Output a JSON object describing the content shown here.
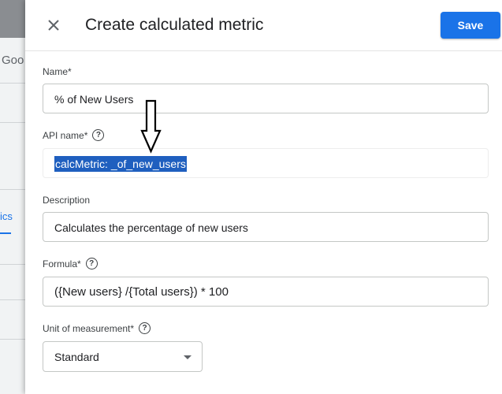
{
  "background": {
    "brand_fragment": "Goo",
    "tab_fragment": "ics"
  },
  "dialog": {
    "title": "Create calculated metric",
    "save_label": "Save"
  },
  "fields": {
    "name": {
      "label": "Name*",
      "value": "% of New Users"
    },
    "api_name": {
      "label": "API name*",
      "value_part1": "calcMetric:",
      "value_part2": "_of_new_users"
    },
    "description": {
      "label": "Description",
      "value": "Calculates the percentage of new users"
    },
    "formula": {
      "label": "Formula*",
      "value": "({New users} /{Total users}) * 100"
    },
    "unit": {
      "label": "Unit of measurement*",
      "value": "Standard"
    }
  },
  "icons": {
    "close": "close-icon",
    "help": "help-circle-icon",
    "dropdown": "dropdown-arrow-icon",
    "annotation": "down-arrow-annotation-icon"
  },
  "colors": {
    "accent": "#1a73e8",
    "selection": "#1f5fbf"
  }
}
